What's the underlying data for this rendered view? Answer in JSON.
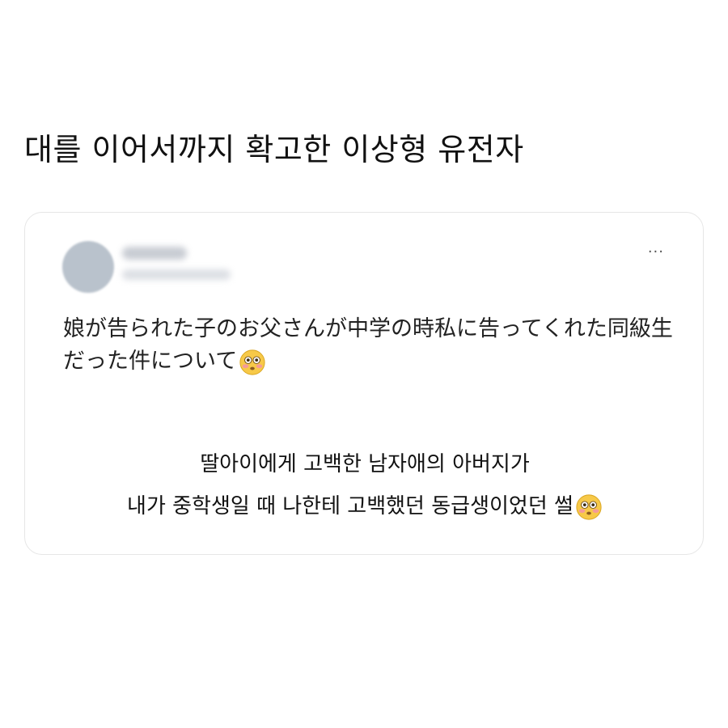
{
  "page": {
    "title": "대를 이어서까지 확고한 이상형 유전자"
  },
  "tweet": {
    "more_label": "···",
    "text": "娘が告られた子のお父さんが中学の時私に告ってくれた同級生だった件について",
    "emoji": "flushed-face-icon"
  },
  "translation": {
    "line1": "딸아이에게 고백한 남자애의 아버지가",
    "line2": "내가 중학생일 때 나한테 고백했던 동급생이었던 썰"
  }
}
